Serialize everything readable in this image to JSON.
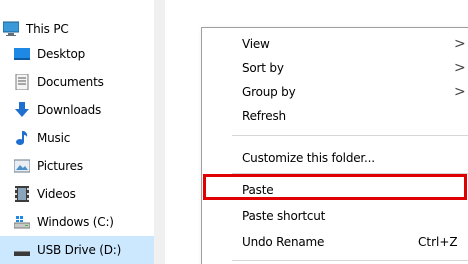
{
  "nav": {
    "items": [
      {
        "label": "This PC",
        "icon": "this-pc-icon"
      },
      {
        "label": "Desktop",
        "icon": "desktop-icon"
      },
      {
        "label": "Documents",
        "icon": "documents-icon"
      },
      {
        "label": "Downloads",
        "icon": "downloads-icon"
      },
      {
        "label": "Music",
        "icon": "music-icon"
      },
      {
        "label": "Pictures",
        "icon": "pictures-icon"
      },
      {
        "label": "Videos",
        "icon": "videos-icon"
      },
      {
        "label": "Windows (C:)",
        "icon": "windows-drive-icon"
      },
      {
        "label": "USB Drive (D:)",
        "icon": "usb-drive-icon",
        "selected": true
      }
    ]
  },
  "menu": {
    "view": "View",
    "sort_by": "Sort by",
    "group_by": "Group by",
    "refresh": "Refresh",
    "customize": "Customize this folder...",
    "paste": "Paste",
    "paste_shortcut": "Paste shortcut",
    "undo_rename": "Undo Rename",
    "undo_shortcut": "Ctrl+Z",
    "submenu_arrow": ">"
  },
  "colors": {
    "selection": "#cce8ff",
    "highlight": "#e00000",
    "folder_blue": "#1e88e5"
  }
}
